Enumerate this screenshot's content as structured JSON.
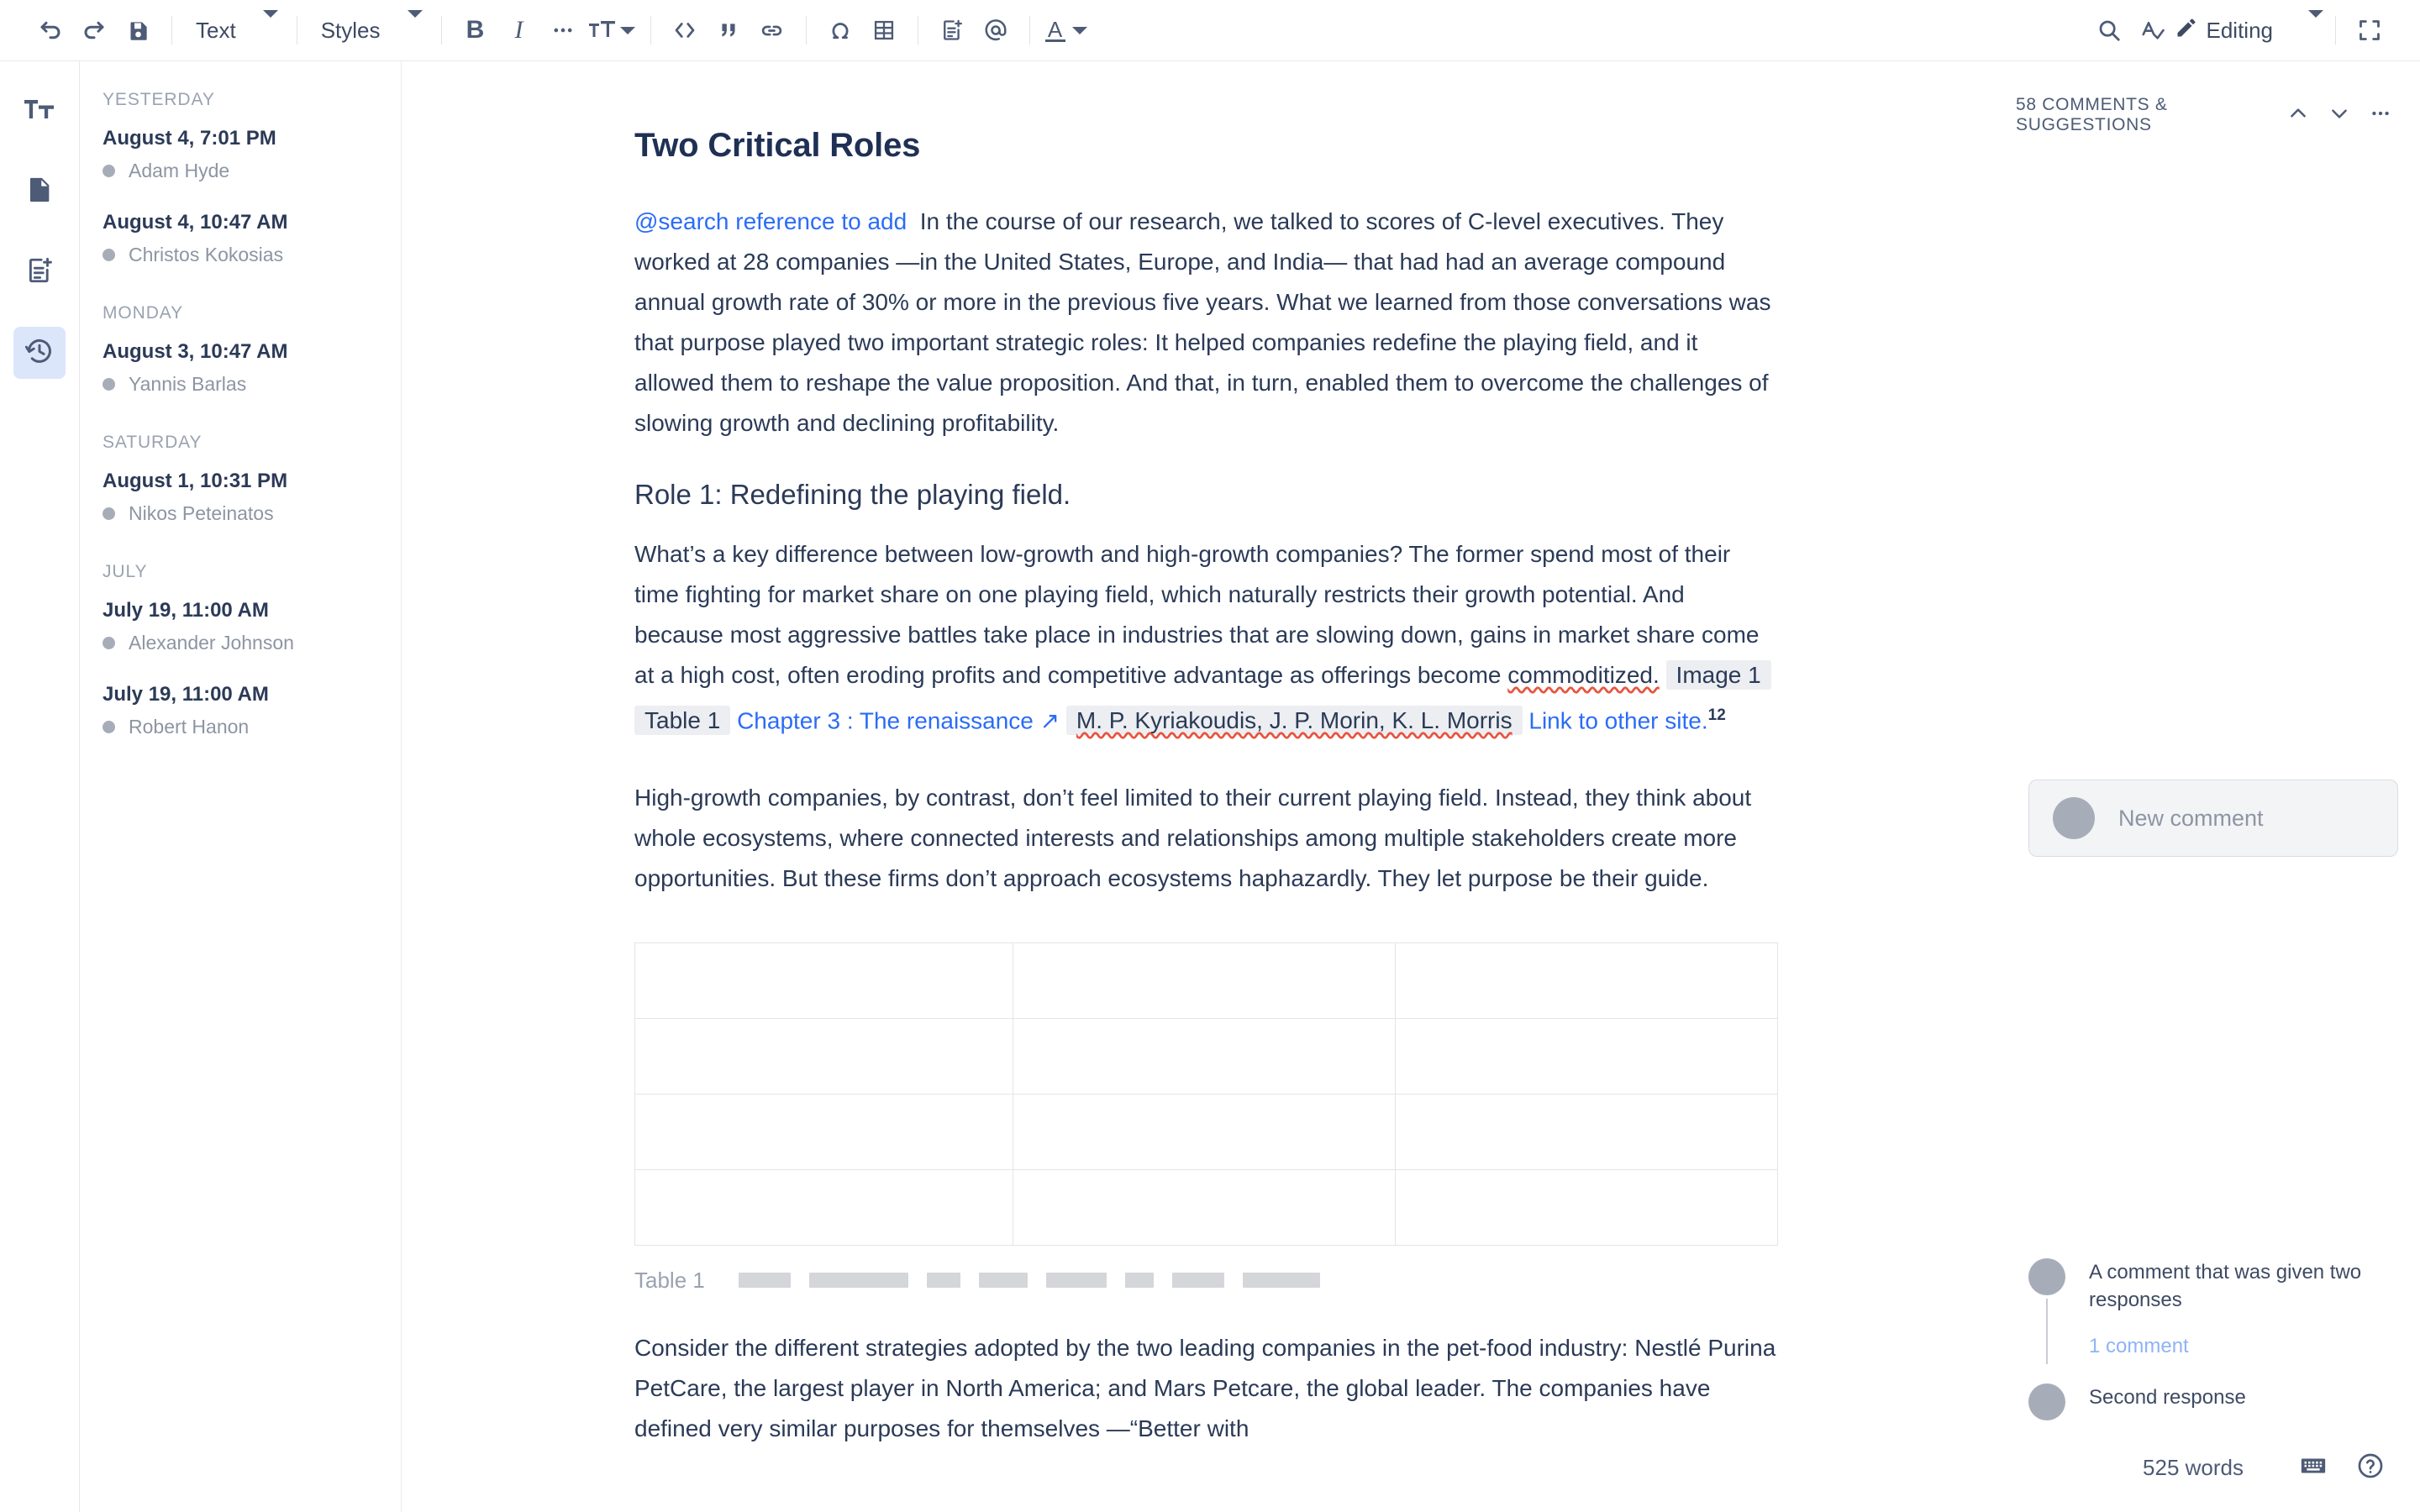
{
  "toolbar": {
    "undo": "undo-icon",
    "redo": "redo-icon",
    "save": "save-icon",
    "block_type": "Text",
    "styles": "Styles",
    "bold": "B",
    "italic": "I",
    "more": "more-icon",
    "font_size": "font-size-icon",
    "code": "code-icon",
    "quote": "quote-icon",
    "link": "link-icon",
    "special_char": "omega-icon",
    "table": "table-icon",
    "note": "add-note-icon",
    "mention": "at-icon",
    "text_color": "A",
    "search": "search-icon",
    "spellcheck": "spellcheck-icon",
    "edit_icon": "pencil-icon",
    "mode_label": "Editing",
    "fullscreen": "fullscreen-icon"
  },
  "rail": {
    "items": [
      {
        "name": "styles-panel",
        "icon": "text-format-icon",
        "active": false
      },
      {
        "name": "document-panel",
        "icon": "document-icon",
        "active": false
      },
      {
        "name": "notes-panel",
        "icon": "add-note-icon",
        "active": false
      },
      {
        "name": "history-panel",
        "icon": "history-icon",
        "active": true
      }
    ]
  },
  "revisions": {
    "groups": [
      {
        "label": "YESTERDAY",
        "items": [
          {
            "date": "August 4, 7:01 PM",
            "author": "Adam Hyde"
          },
          {
            "date": "August 4, 10:47 AM",
            "author": "Christos Kokosias"
          }
        ]
      },
      {
        "label": "MONDAY",
        "items": [
          {
            "date": "August 3, 10:47 AM",
            "author": "Yannis Barlas"
          }
        ]
      },
      {
        "label": "SATURDAY",
        "items": [
          {
            "date": "August 1, 10:31 PM",
            "author": "Nikos Peteinatos"
          }
        ]
      },
      {
        "label": "JULY",
        "items": [
          {
            "date": "July 19, 11:00 AM",
            "author": "Alexander Johnson"
          },
          {
            "date": "July 19, 11:00 AM",
            "author": "Robert Hanon"
          }
        ]
      }
    ]
  },
  "document": {
    "title": "Two Critical Roles",
    "para1": {
      "mention": "@search reference to add",
      "text": "In the course of our research, we talked to scores of C-level executives. They worked at 28 companies —in the United States, Europe, and India— that had had an average compound annual growth rate of 30% or more in the previous five years. What we learned from those conversations was that purpose played two important strategic roles: It helped companies redefine the playing field, and it allowed them to reshape the value proposition. And that, in turn, enabled them to overcome the challenges of slowing growth and declining profitability."
    },
    "heading2": "Role 1: Redefining the playing field.",
    "para2": {
      "text_before": "What’s a key difference between low-growth and high-growth companies? The former spend most of their time fighting for market share on one playing field, which naturally restricts their growth potential. And because most aggressive battles take place in industries that are slowing down, gains in market share come at a high cost, often eroding profits and competitive advantage as offerings become ",
      "misspelled": "commoditized.",
      "xref_image": "Image 1",
      "xref_table": "Table 1",
      "link_chapter": "Chapter 3 : The renaissance",
      "citation": "M. P. Kyriakoudis, J. P. Morin, K. L. Morris",
      "link_other": "Link to other site.",
      "footnote": "12"
    },
    "para3": "High-growth companies, by contrast, don’t feel limited to their current playing field. Instead, they think about whole ecosystems, where connected interests and relationships among multiple stakeholders create more opportunities. But these firms don’t approach ecosystems haphazardly. They let purpose be their guide.",
    "table": {
      "rows": 4,
      "cols": 3,
      "caption_label": "Table 1",
      "caption_bars": [
        62,
        118,
        40,
        58,
        72,
        34,
        62,
        92
      ]
    },
    "para4": "Consider the different strategies adopted by the two leading companies in the pet-food industry: Nestlé Purina PetCare, the largest player in North America; and Mars Petcare, the global leader. The companies have defined very similar purposes for themselves —“Better with"
  },
  "comments": {
    "header": "58 COMMENTS & SUGGESTIONS",
    "up": "chevron-up-icon",
    "down": "chevron-down-icon",
    "more": "more-icon",
    "new_comment_placeholder": "New comment",
    "thread": [
      {
        "text": "A comment that was given two responses",
        "count": "1 comment"
      },
      {
        "text": "Second response",
        "count": ""
      }
    ]
  },
  "status": {
    "word_count": "525 words",
    "keyboard": "keyboard-icon",
    "help": "help-icon"
  },
  "colors": {
    "accent_blue": "#2b6cf6",
    "text_dark": "#2b3a57",
    "icon_gray": "#4d5b76",
    "muted": "#8d95a3",
    "active_bg": "#dbe6fb",
    "chip_bg": "#eceef1"
  }
}
